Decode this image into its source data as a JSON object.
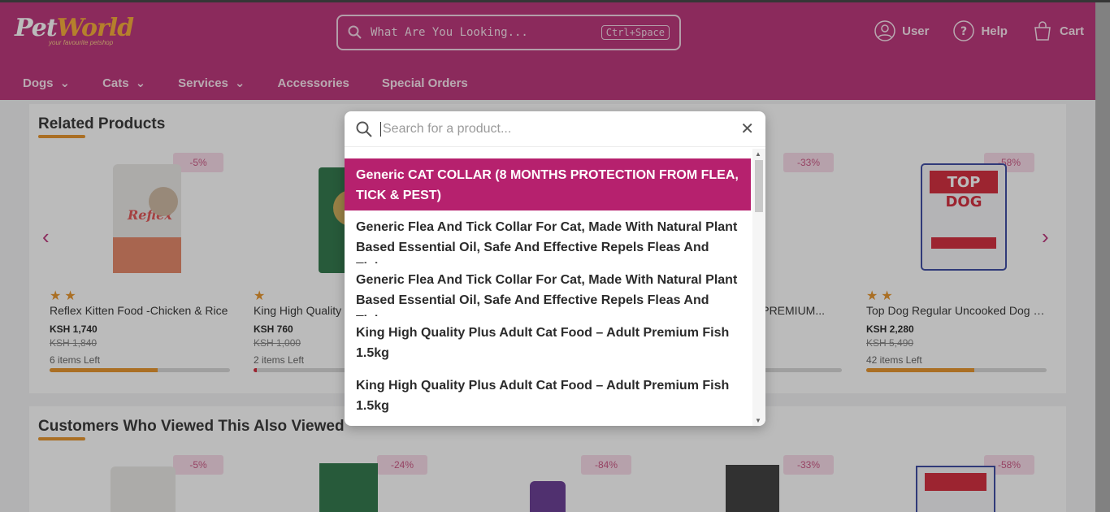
{
  "header": {
    "logo_text_a": "Pet",
    "logo_text_b": "World",
    "logo_tagline": "your favourite petshop",
    "search_placeholder": "What Are You Looking...",
    "search_shortcut": "Ctrl+Space",
    "actions": [
      {
        "label": "User",
        "icon": "user-icon"
      },
      {
        "label": "Help",
        "icon": "help-icon"
      },
      {
        "label": "Cart",
        "icon": "cart-icon"
      }
    ]
  },
  "nav": [
    {
      "label": "Dogs",
      "dropdown": true
    },
    {
      "label": "Cats",
      "dropdown": true
    },
    {
      "label": "Services",
      "dropdown": true
    },
    {
      "label": "Accessories",
      "dropdown": false
    },
    {
      "label": "Special Orders",
      "dropdown": false
    }
  ],
  "related": {
    "title": "Related Products",
    "products": [
      {
        "badge": "-5%",
        "name": "Reflex Kitten Food -Chicken & Rice",
        "price": "KSH 1,740",
        "old_price": "KSH 1,840",
        "stock": "6 items Left",
        "stars": "★★",
        "stock_fill": 0.6
      },
      {
        "badge": "",
        "name": "King High Quality",
        "price": "KSH 760",
        "old_price": "KSH 1,000",
        "stock": "2 items Left",
        "stars": "★",
        "stock_fill": 0.02
      },
      {
        "badge": "-33%",
        "name": "K PREMIUM...",
        "price": "",
        "old_price": "",
        "stock": "",
        "stars": "",
        "stock_fill": 0
      },
      {
        "badge": "-58%",
        "name": "Top Dog Regular Uncooked Dog Food",
        "price": "KSH 2,280",
        "old_price": "KSH 5,490",
        "stock": "42 items Left",
        "stars": "★★",
        "stock_fill": 0.6
      }
    ]
  },
  "viewed": {
    "title": "Customers Who Viewed This Also Viewed",
    "badges": [
      "-5%",
      "-24%",
      "-84%",
      "-33%",
      "-58%"
    ]
  },
  "modal": {
    "placeholder": "Search for a product...",
    "results": [
      "Generic CAT COLLAR (8 MONTHS PROTECTION FROM FLEA, TICK & PEST)",
      "Generic Flea And Tick Collar For Cat, Made With Natural Plant Based Essential Oil, Safe And Effective Repels Fleas And Ticks,...",
      "Generic Flea And Tick Collar For Cat, Made With Natural Plant Based Essential Oil, Safe And Effective Repels Fleas And Ticks,...",
      "King High Quality Plus Adult Cat Food – Adult Premium Fish 1.5kg",
      "King High Quality Plus Adult Cat Food – Adult Premium Fish 1.5kg"
    ]
  },
  "colors": {
    "brand": "#b6216e",
    "accent": "#e58a18"
  }
}
